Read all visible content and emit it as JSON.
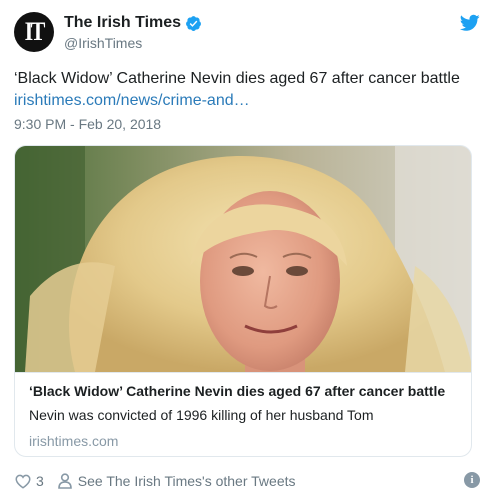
{
  "author": {
    "logo_text": "IT",
    "display_name": "The Irish Times",
    "handle": "@IrishTimes"
  },
  "tweet": {
    "text": "‘Black Widow’ Catherine Nevin dies aged 67 after cancer battle",
    "link": "irishtimes.com/news/crime-and…",
    "timestamp": "9:30 PM - Feb 20, 2018"
  },
  "card": {
    "title": "‘Black Widow’ Catherine Nevin dies aged 67 after cancer battle",
    "description": "Nevin was convicted of 1996 killing of her husband Tom",
    "domain": "irishtimes.com"
  },
  "footer": {
    "like_count": "3",
    "other_tweets_label": "See The Irish Times's other Tweets",
    "info_glyph": "i"
  },
  "colors": {
    "link": "#2b7bb9",
    "twitter_blue": "#1da1f2",
    "secondary_text": "#697882",
    "border": "#e1e8ed"
  },
  "icons": [
    "verified-badge-icon",
    "twitter-bird-icon",
    "heart-icon",
    "person-icon",
    "info-icon"
  ]
}
